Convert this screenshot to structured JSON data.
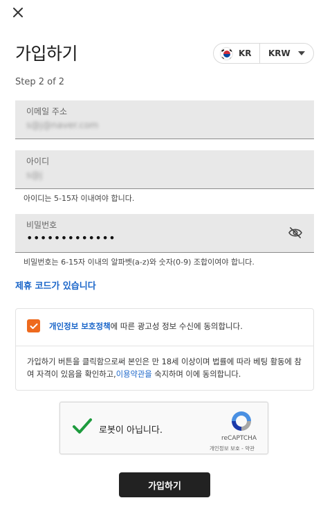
{
  "header": {
    "close_icon": "close-icon",
    "title": "가입하기"
  },
  "locale": {
    "country_code": "KR",
    "flag_icon": "south-korea-flag-icon",
    "currency": "KRW",
    "caret_icon": "chevron-down-icon"
  },
  "step": "Step 2 of 2",
  "form": {
    "email": {
      "label": "이메일 주소",
      "value": "s@j@naver.com"
    },
    "username": {
      "label": "아이디",
      "value": "s@j",
      "hint": "아이디는 5-15자 이내여야 합니다."
    },
    "password": {
      "label": "비밀번호",
      "value": "•••••••••••••",
      "toggle_icon": "eye-off-icon",
      "hint": "비밀번호는 6-15자 이내의 알파벳(a-z)와 숫자(0-9) 조합이여야 합니다."
    }
  },
  "promo_link": "제휴 코드가 있습니다",
  "consent": {
    "marketing": {
      "checked": true,
      "link_text": "개인정보 보호정책",
      "text": "에 따른 광고성 정보 수신에 동의합니다."
    },
    "terms": {
      "text_before": "가입하기 버튼을 클릭함으로써 본인은 만 18세 이상이며 법률에 따라 베팅 활동에 참여 자격이 있음을 확인하고,",
      "link_text": "이용약관을",
      "text_after": " 숙지하며 이에 동의합니다."
    }
  },
  "captcha": {
    "label": "로봇이 아닙니다.",
    "brand": "reCAPTCHA",
    "links": "개인정보 보호 - 약관",
    "verified": true
  },
  "submit_label": "가입하기",
  "colors": {
    "accent_orange": "#ee6a1e",
    "link_blue": "#1b66c9",
    "button_dark": "#222222",
    "field_bg": "#e8e8e8"
  }
}
